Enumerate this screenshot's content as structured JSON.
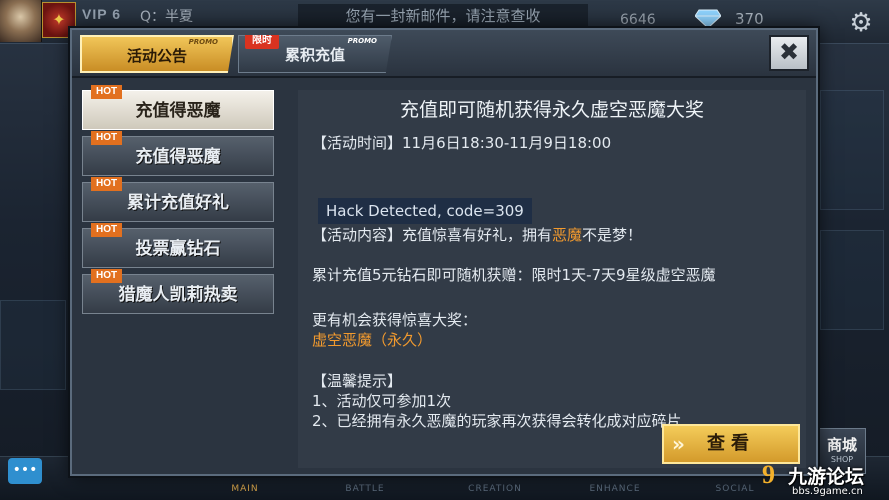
{
  "hud": {
    "vip": "VIP 6",
    "player": "Q：半夏",
    "mail_tip": "您有一封新邮件，请注意查收",
    "gold": "6646",
    "gems": "370",
    "icons": [
      "avatar",
      "rank-badge-icon",
      "gem-icon",
      "gear-icon"
    ]
  },
  "bottom_nav": {
    "tabs": [
      {
        "en": "MAIN",
        "active": true
      },
      {
        "en": "BATTLE",
        "active": false
      },
      {
        "en": "CREATION",
        "active": false
      },
      {
        "en": "ENHANCE",
        "active": false
      },
      {
        "en": "SOCIAL",
        "active": false
      }
    ],
    "shop_cn": "商城",
    "shop_en": "SHOP",
    "chat_icon": "chat-bubble-icon"
  },
  "watermark": {
    "logo": "9",
    "name": "九游论坛",
    "url": "bbs.9game.cn"
  },
  "dialog": {
    "tabs": [
      {
        "label": "活动公告",
        "promo": "PROMO",
        "active": true
      },
      {
        "label": "累积充值",
        "promo": "PROMO",
        "badge": "限时",
        "active": false
      }
    ],
    "close_label": "✖",
    "side_items": [
      {
        "hot": "HOT",
        "label": "充值得恶魔",
        "active": true
      },
      {
        "hot": "HOT",
        "label": "充值得恶魔",
        "active": false
      },
      {
        "hot": "HOT",
        "label": "累计充值好礼",
        "active": false
      },
      {
        "hot": "HOT",
        "label": "投票赢钻石",
        "active": false
      },
      {
        "hot": "HOT",
        "label": "猎魔人凯莉热卖",
        "active": false
      }
    ],
    "content": {
      "title": "充值即可随机获得永久虚空恶魔大奖",
      "time": "【活动时间】11月6日18:30-11月9日18:00",
      "hack": "Hack Detected, code=309",
      "content_prefix": "【活动内容】充值惊喜有好礼，拥有",
      "content_highlight": "恶魔",
      "content_suffix": "不是梦！",
      "detail": "累计充值5元钻石即可随机获赠：限时1天-7天9星级虚空恶魔",
      "more": "更有机会获得惊喜大奖：",
      "prize": "虚空恶魔（永久）",
      "tips_title": "【温馨提示】",
      "tip1": "1、活动仅可参加1次",
      "tip2": "2、已经拥有永久恶魔的玩家再次获得会转化成对应碎片"
    },
    "view_button": "查看"
  },
  "colors": {
    "gold_tab": "#e2b044",
    "hot_badge": "#e2701f",
    "highlight": "#f29a2e",
    "limited_badge": "#d93320"
  }
}
